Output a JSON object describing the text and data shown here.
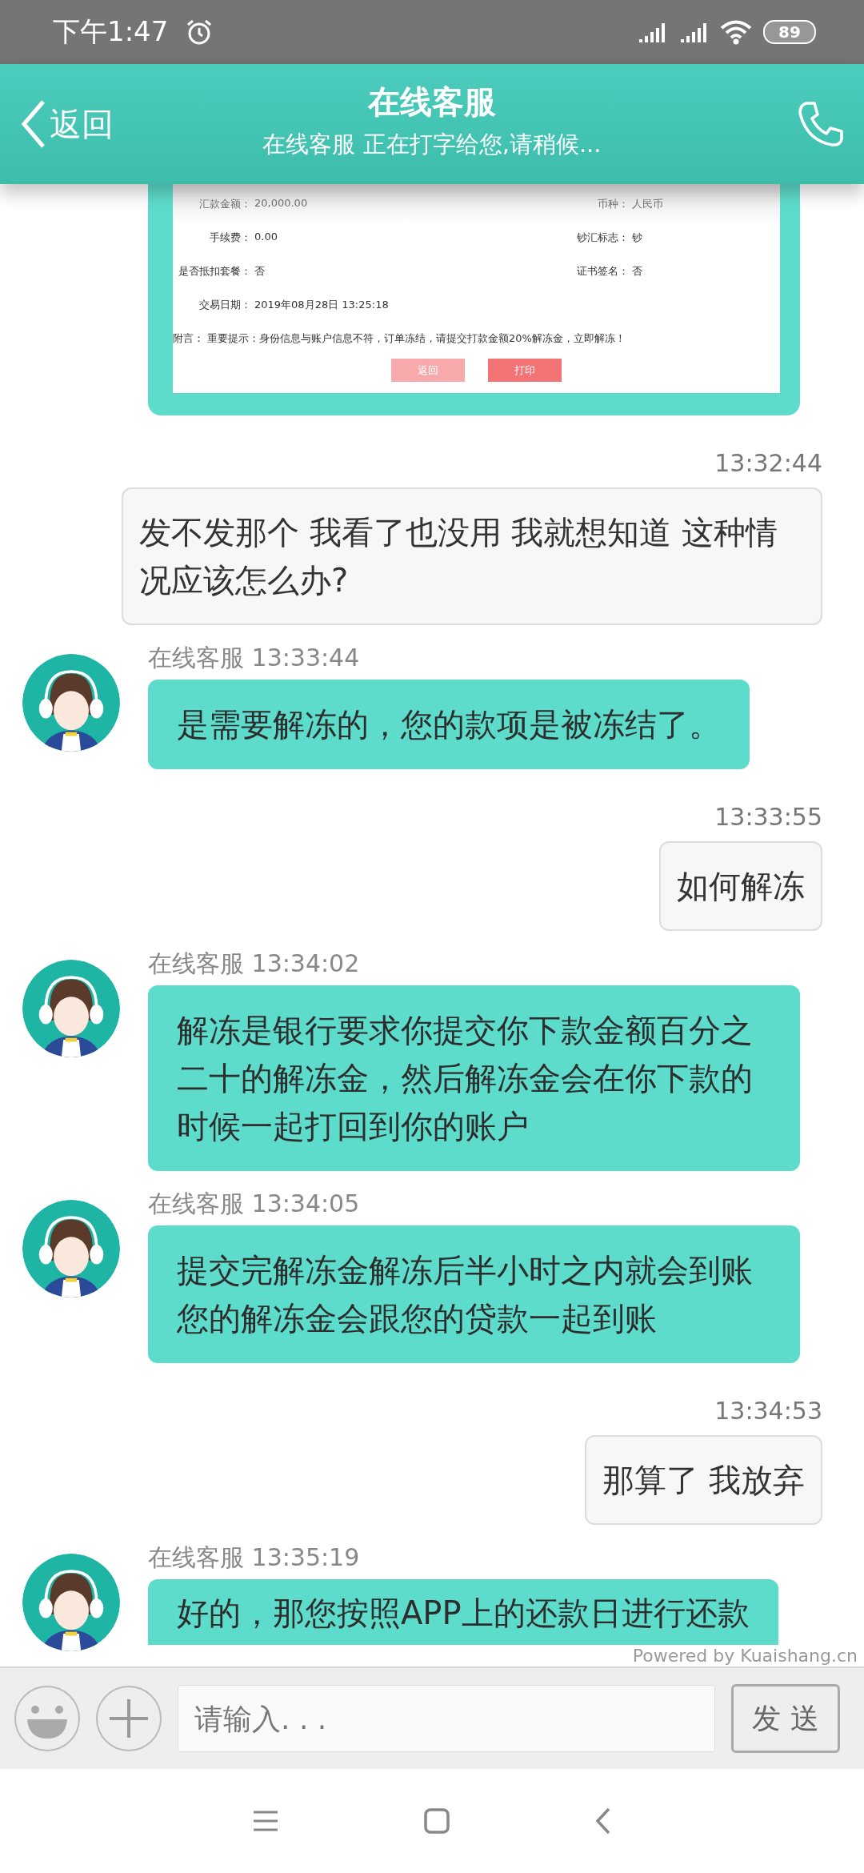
{
  "status_bar": {
    "time": "下午1:47",
    "battery": "89"
  },
  "header": {
    "back": "返回",
    "title": "在线客服",
    "subtitle": "在线客服 正在打字给您,请稍候..."
  },
  "receipt": {
    "rows": [
      {
        "fields": [
          {
            "label": "汇款金额：",
            "value": "20,000.00"
          },
          {
            "label": "币种：",
            "value": "人民币"
          }
        ]
      },
      {
        "fields": [
          {
            "label": "手续费：",
            "value": "0.00"
          },
          {
            "label": "钞汇标志：",
            "value": "钞"
          }
        ]
      },
      {
        "fields": [
          {
            "label": "是否抵扣套餐：",
            "value": "否"
          },
          {
            "label": "证书签名：",
            "value": "否"
          }
        ]
      },
      {
        "fields": [
          {
            "label": "交易日期：",
            "value": "2019年08月28日 13:25:18"
          }
        ]
      },
      {
        "fields": [
          {
            "label": "附言：",
            "value": "重要提示：身份信息与账户信息不符，订单冻结，请提交打款金额20%解冻金，立即解冻！"
          }
        ]
      }
    ],
    "buttons": [
      {
        "label": "返回",
        "kind": "secondary"
      },
      {
        "label": "打印",
        "kind": "primary"
      }
    ]
  },
  "messages": [
    {
      "kind": "user",
      "time": "13:32:44",
      "text": "发不发那个 我看了也没用 我就想知道 这种情况应该怎么办?"
    },
    {
      "kind": "agent",
      "sender": "在线客服",
      "time": "13:33:44",
      "text": "是需要解冻的，您的款项是被冻结了。"
    },
    {
      "kind": "user",
      "time": "13:33:55",
      "text": "如何解冻"
    },
    {
      "kind": "agent",
      "sender": "在线客服",
      "time": "13:34:02",
      "text": "解冻是银行要求你提交你下款金额百分之二十的解冻金，然后解冻金会在你下款的时候一起打回到你的账户"
    },
    {
      "kind": "agent",
      "sender": "在线客服",
      "time": "13:34:05",
      "text": "提交完解冻金解冻后半小时之内就会到账您的解冻金会跟您的贷款一起到账"
    },
    {
      "kind": "user",
      "time": "13:34:53",
      "text": "那算了 我放弃"
    },
    {
      "kind": "agent",
      "sender": "在线客服",
      "time": "13:35:19",
      "text": "好的，那您按照APP上的还款日进行还款"
    }
  ],
  "branding": "Powered by Kuaishang.cn",
  "composer": {
    "placeholder": "请输入. . .",
    "send": "发 送"
  }
}
